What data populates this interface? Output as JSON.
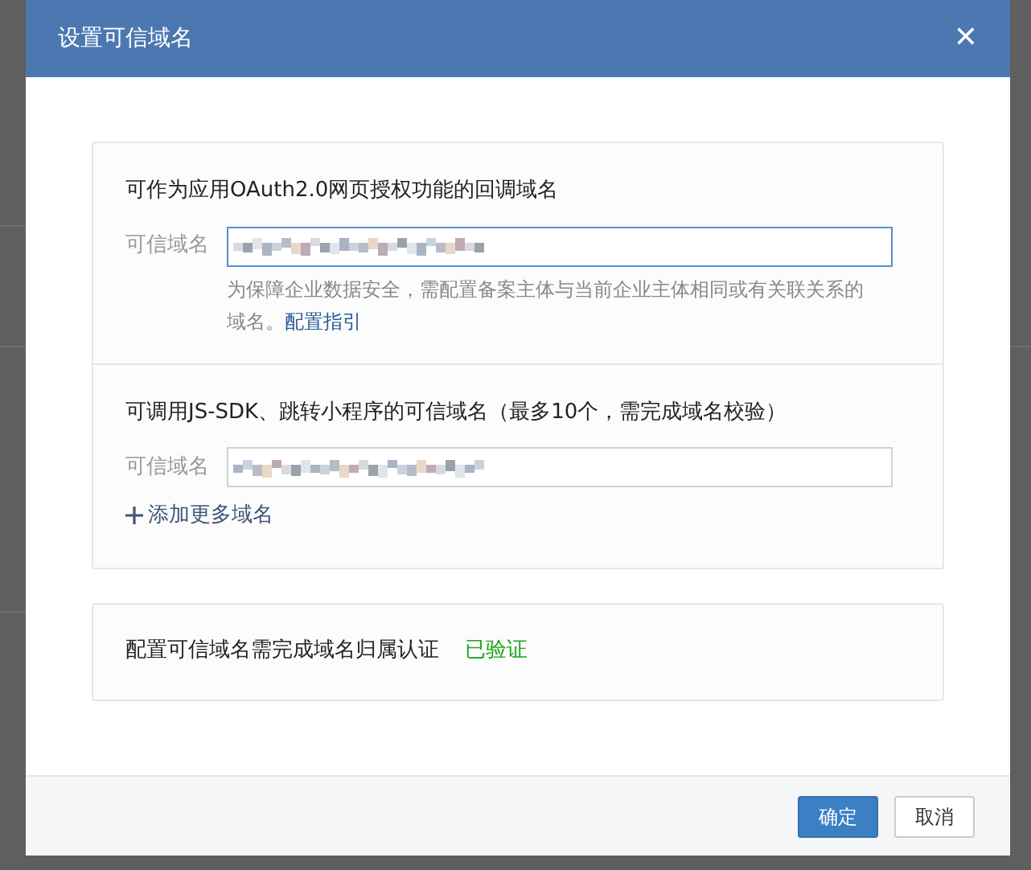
{
  "dialog": {
    "title": "设置可信域名",
    "close": "✕"
  },
  "oauth_section": {
    "heading": "可作为应用OAuth2.0网页授权功能的回调域名",
    "label": "可信域名",
    "focused": true,
    "hint": "为保障企业数据安全，需配置备案主体与当前企业主体相同或有关联关系的域名。",
    "link": "配置指引"
  },
  "jssdk_section": {
    "heading": "可调用JS-SDK、跳转小程序的可信域名（最多10个，需完成域名校验）",
    "label": "可信域名",
    "focused": false,
    "add_link": "添加更多域名"
  },
  "verify_section": {
    "text": "配置可信域名需完成域名归属认证",
    "status": "已验证",
    "verified": true
  },
  "buttons": [
    {
      "label": "确定",
      "kind": "primary"
    },
    {
      "label": "取消",
      "kind": "secondary"
    }
  ]
}
